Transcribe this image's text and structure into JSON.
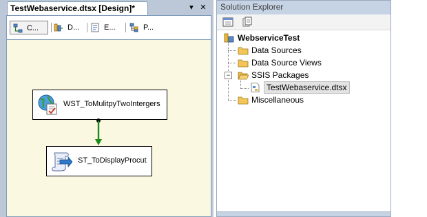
{
  "document": {
    "tab_title": "TestWebaservice.dtsx [Design]*",
    "controls": {
      "pin": "▾",
      "close": "✕"
    },
    "designer_tabs": [
      {
        "label": "C...",
        "icon": "control-flow-icon",
        "active": true
      },
      {
        "label": "D...",
        "icon": "data-flow-icon",
        "active": false
      },
      {
        "label": "E...",
        "icon": "event-handlers-icon",
        "active": false
      },
      {
        "label": "P...",
        "icon": "package-explorer-icon",
        "active": false
      }
    ],
    "tasks": [
      {
        "name": "WST_ToMulitpyTwoIntergers",
        "icon": "web-service-task-icon"
      },
      {
        "name": "ST_ToDisplayProcut",
        "icon": "script-task-icon"
      }
    ]
  },
  "solution_explorer": {
    "title": "Solution Explorer",
    "toolbar": [
      "properties-icon",
      "show-all-files-icon"
    ],
    "project": "WebserviceTest",
    "folders": [
      {
        "label": "Data Sources"
      },
      {
        "label": "Data Source Views"
      },
      {
        "label": "SSIS Packages",
        "expanded": true,
        "expander": "−"
      },
      {
        "label": "Miscellaneous"
      }
    ],
    "package_item": "TestWebaservice.dtsx"
  },
  "colors": {
    "accent": "#c6d3e4",
    "connector": "#1b8a1b",
    "canvas": "#fbf8e1"
  }
}
